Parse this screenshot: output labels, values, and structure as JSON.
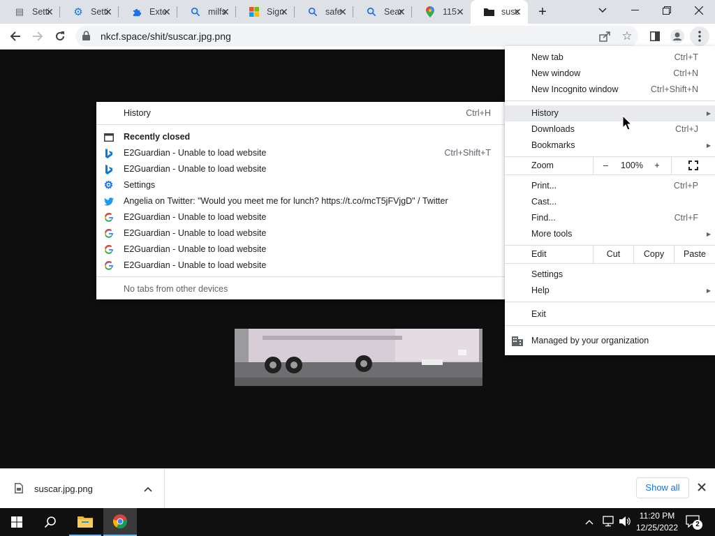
{
  "tabs": [
    {
      "title": "Setti",
      "icon": "settings-page-icon"
    },
    {
      "title": "Setti",
      "icon": "gear-icon"
    },
    {
      "title": "Exte",
      "icon": "puzzle-icon"
    },
    {
      "title": "milfs",
      "icon": "search-icon"
    },
    {
      "title": "Sign",
      "icon": "microsoft-icon"
    },
    {
      "title": "safe",
      "icon": "search-icon"
    },
    {
      "title": "Sear",
      "icon": "search-icon"
    },
    {
      "title": "115",
      "icon": "maps-icon"
    },
    {
      "title": "susc",
      "icon": "folder-icon"
    }
  ],
  "toolbar": {
    "url": "nkcf.space/shit/suscar.jpg.png"
  },
  "chrome_menu": {
    "new_tab": {
      "label": "New tab",
      "shortcut": "Ctrl+T"
    },
    "new_window": {
      "label": "New window",
      "shortcut": "Ctrl+N"
    },
    "new_incognito": {
      "label": "New Incognito window",
      "shortcut": "Ctrl+Shift+N"
    },
    "history": {
      "label": "History"
    },
    "downloads": {
      "label": "Downloads",
      "shortcut": "Ctrl+J"
    },
    "bookmarks": {
      "label": "Bookmarks"
    },
    "zoom": {
      "label": "Zoom",
      "minus": "–",
      "value": "100%",
      "plus": "+"
    },
    "print": {
      "label": "Print...",
      "shortcut": "Ctrl+P"
    },
    "cast": {
      "label": "Cast..."
    },
    "find": {
      "label": "Find...",
      "shortcut": "Ctrl+F"
    },
    "more_tools": {
      "label": "More tools"
    },
    "edit": {
      "label": "Edit",
      "cut": "Cut",
      "copy": "Copy",
      "paste": "Paste"
    },
    "settings": {
      "label": "Settings"
    },
    "help": {
      "label": "Help"
    },
    "exit": {
      "label": "Exit"
    },
    "managed": {
      "label": "Managed by your organization"
    }
  },
  "history_menu": {
    "history": {
      "label": "History",
      "shortcut": "Ctrl+H"
    },
    "recently_closed": "Recently closed",
    "items": [
      {
        "label": "E2Guardian - Unable to load website",
        "shortcut": "Ctrl+Shift+T",
        "icon": "bing-icon"
      },
      {
        "label": "E2Guardian - Unable to load website",
        "shortcut": "",
        "icon": "bing-icon"
      },
      {
        "label": "Settings",
        "shortcut": "",
        "icon": "gear-icon"
      },
      {
        "label": "Angelia on Twitter: \"Would you meet me for lunch? https://t.co/mcT5jFVjgD\" / Twitter",
        "shortcut": "",
        "icon": "twitter-icon"
      },
      {
        "label": "E2Guardian - Unable to load website",
        "shortcut": "",
        "icon": "google-icon"
      },
      {
        "label": "E2Guardian - Unable to load website",
        "shortcut": "",
        "icon": "google-icon"
      },
      {
        "label": "E2Guardian - Unable to load website",
        "shortcut": "",
        "icon": "google-icon"
      },
      {
        "label": "E2Guardian - Unable to load website",
        "shortcut": "",
        "icon": "google-icon"
      }
    ],
    "no_tabs": "No tabs from other devices"
  },
  "download_bar": {
    "filename": "suscar.jpg.png",
    "show_all": "Show all"
  },
  "taskbar": {
    "time": "11:20 PM",
    "date": "12/25/2022",
    "notification_count": "2"
  },
  "colors": {
    "accent": "#1a73e8",
    "google_blue": "#4285f4",
    "twitter": "#1d9bf0",
    "bing": "#0a7bd6"
  }
}
